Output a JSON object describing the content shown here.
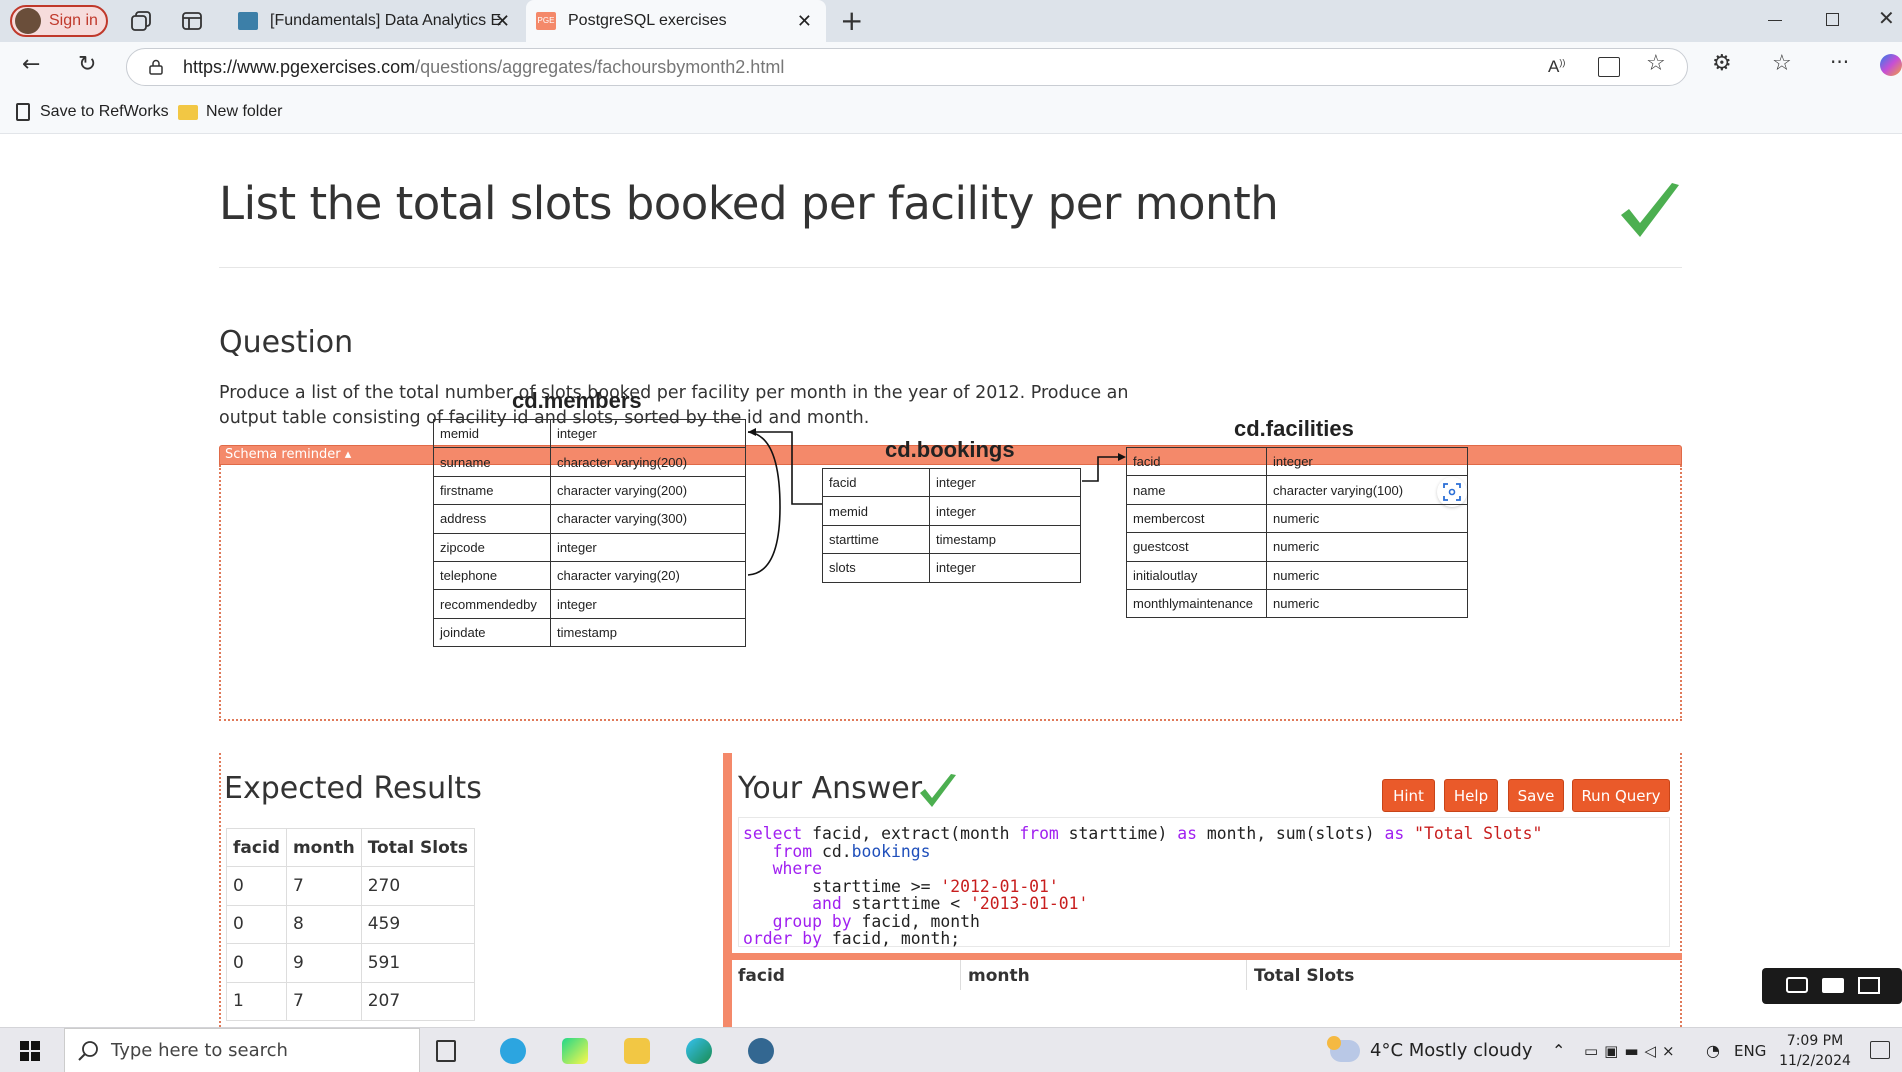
{
  "browser": {
    "sign_in": "Sign in",
    "tabs": [
      {
        "title": "[Fundamentals] Data Analytics En",
        "active": false
      },
      {
        "title": "PostgreSQL exercises",
        "active": true
      }
    ],
    "url_host": "https://www.pgexercises.com",
    "url_path": "/questions/aggregates/fachoursbymonth2.html",
    "bookmarks": [
      "Save to RefWorks",
      "New folder"
    ]
  },
  "page": {
    "title": "List the total slots booked per facility per month",
    "question_heading": "Question",
    "question_text": "Produce a list of the total number of slots booked per facility per month in the year of 2012. Produce an output table consisting of facility id and slots, sorted by the id and month.",
    "schema_toggle": "Schema reminder ▴",
    "schema": {
      "members": {
        "title": "cd.members",
        "rows": [
          [
            "memid",
            "integer"
          ],
          [
            "surname",
            "character varying(200)"
          ],
          [
            "firstname",
            "character varying(200)"
          ],
          [
            "address",
            "character varying(300)"
          ],
          [
            "zipcode",
            "integer"
          ],
          [
            "telephone",
            "character varying(20)"
          ],
          [
            "recommendedby",
            "integer"
          ],
          [
            "joindate",
            "timestamp"
          ]
        ]
      },
      "bookings": {
        "title": "cd.bookings",
        "rows": [
          [
            "facid",
            "integer"
          ],
          [
            "memid",
            "integer"
          ],
          [
            "starttime",
            "timestamp"
          ],
          [
            "slots",
            "integer"
          ]
        ]
      },
      "facilities": {
        "title": "cd.facilities",
        "rows": [
          [
            "facid",
            "integer"
          ],
          [
            "name",
            "character varying(100)"
          ],
          [
            "membercost",
            "numeric"
          ],
          [
            "guestcost",
            "numeric"
          ],
          [
            "initialoutlay",
            "numeric"
          ],
          [
            "monthlymaintenance",
            "numeric"
          ]
        ]
      }
    },
    "expected": {
      "heading": "Expected Results",
      "columns": [
        "facid",
        "month",
        "Total Slots"
      ],
      "rows": [
        [
          "0",
          "7",
          "270"
        ],
        [
          "0",
          "8",
          "459"
        ],
        [
          "0",
          "9",
          "591"
        ],
        [
          "1",
          "7",
          "207"
        ]
      ]
    },
    "answer": {
      "heading": "Your Answer",
      "buttons": [
        "Hint",
        "Help",
        "Save",
        "Run Query"
      ],
      "code_lines": [
        "select facid, extract(month from starttime) as month, sum(slots) as \"Total Slots\"",
        "   from cd.bookings",
        "   where",
        "       starttime >= '2012-01-01'",
        "       and starttime < '2013-01-01'",
        "   group by facid, month",
        "order by facid, month;"
      ],
      "result_columns": [
        "facid",
        "month",
        "Total Slots"
      ]
    }
  },
  "taskbar": {
    "search_placeholder": "Type here to search",
    "weather": "4°C  Mostly cloudy",
    "language": "ENG",
    "time": "7:09 PM",
    "date": "11/2/2024"
  },
  "colors": {
    "accent": "#f4896a",
    "button": "#ea5a2a",
    "check": "#4caf50"
  }
}
